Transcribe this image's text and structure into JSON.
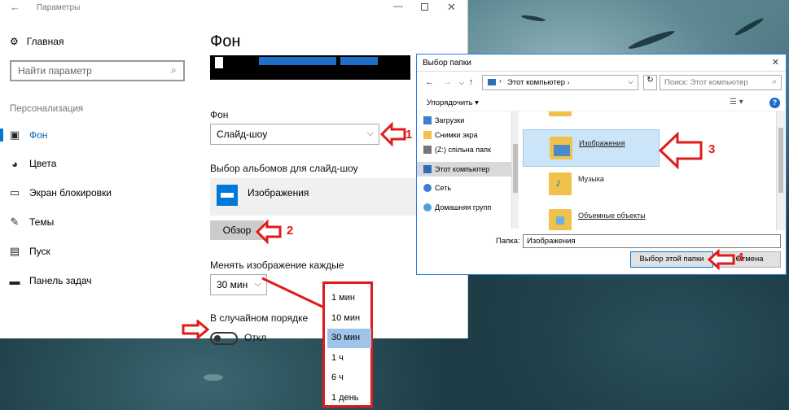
{
  "settings": {
    "title": "Параметры",
    "home": "Главная",
    "search_placeholder": "Найти параметр",
    "section": "Персонализация",
    "nav": [
      {
        "label": "Фон",
        "icon": "picture-icon"
      },
      {
        "label": "Цвета",
        "icon": "palette-icon"
      },
      {
        "label": "Экран блокировки",
        "icon": "monitor-icon"
      },
      {
        "label": "Темы",
        "icon": "brush-icon"
      },
      {
        "label": "Пуск",
        "icon": "start-icon"
      },
      {
        "label": "Панель задач",
        "icon": "taskbar-icon"
      }
    ],
    "active_nav": "Фон",
    "page_title": "Фон",
    "background_label": "Фон",
    "background_value": "Слайд-шоу",
    "albums_label": "Выбор альбомов для слайд-шоу",
    "album_name": "Изображения",
    "browse_label": "Обзор",
    "interval_label": "Менять изображение каждые",
    "interval_value": "30 мин",
    "shuffle_label": "В случайном порядке",
    "shuffle_state": "Откл"
  },
  "interval_options": [
    "1 мин",
    "10 мин",
    "30 мин",
    "1 ч",
    "6 ч",
    "1 день"
  ],
  "interval_selected": "30 мин",
  "dialog": {
    "title": "Выбор папки",
    "address": "Этот компьютер",
    "search_placeholder": "Поиск: Этот компьютер",
    "organize": "Упорядочить",
    "tree": [
      "Загрузки",
      "Снимки экра",
      "(Z:) спільна папк",
      "Этот компьютер",
      "Сеть",
      "Домашняя групп"
    ],
    "files": [
      "Изображения",
      "Музыка",
      "Объемные объекты"
    ],
    "selected_file": "Изображения",
    "folder_label": "Папка:",
    "folder_value": "Изображения",
    "ok_label": "Выбор этой папки",
    "cancel_label": "Отмена"
  },
  "annotations": {
    "steps": [
      "1",
      "2",
      "3",
      "4"
    ],
    "color": "#e01b1b"
  }
}
